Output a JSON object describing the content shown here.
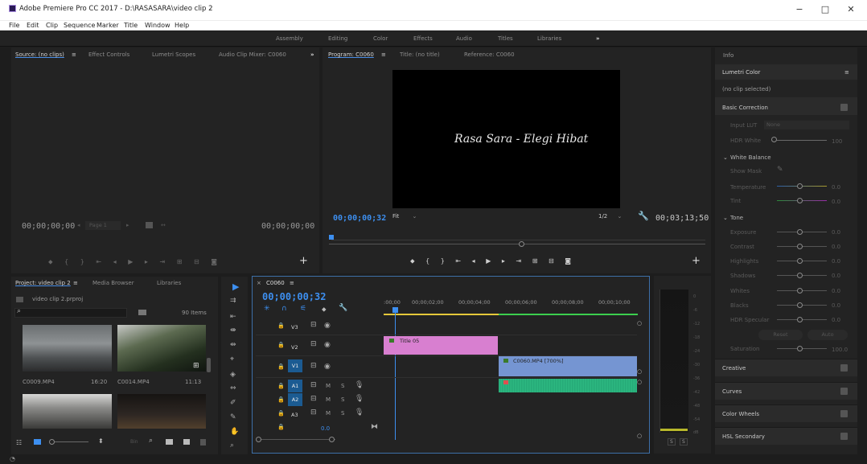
{
  "window": {
    "title": "Adobe Premiere Pro CC 2017 - D:\\RASASARA\\video clip 2",
    "minimize": "−",
    "maximize": "□",
    "close": "✕"
  },
  "menu": [
    "File",
    "Edit",
    "Clip",
    "Sequence",
    "Marker",
    "Title",
    "Window",
    "Help"
  ],
  "workspaces": [
    "Assembly",
    "Editing",
    "Color",
    "Effects",
    "Audio",
    "Titles",
    "Libraries"
  ],
  "workspaces_more": "»",
  "source": {
    "tabs": [
      "Source: (no clips)",
      "Effect Controls",
      "Lumetri Scopes",
      "Audio Clip Mixer: C0060"
    ],
    "menu_icon": "≡",
    "more": "»",
    "timecode_left": "00;00;00;00",
    "timecode_right": "00;00;00;00",
    "page": "Page 1"
  },
  "program": {
    "tabs": [
      "Program: C0060",
      "Title: (no title)",
      "Reference: C0060"
    ],
    "menu_icon": "≡",
    "title_text": "Rasa Sara - Elegi Hibat",
    "timecode": "00;00;00;32",
    "fit": "Fit",
    "resolution": "1/2",
    "duration": "00;03;13;50"
  },
  "project": {
    "tabs": [
      "Project: video clip 2",
      "Media Browser",
      "Libraries"
    ],
    "menu_icon": "≡",
    "file": "video clip 2.prproj",
    "search_placeholder": "",
    "items_count": "90 Items",
    "clips": [
      {
        "name": "C0009.MP4",
        "duration": "16:20"
      },
      {
        "name": "C0014.MP4",
        "duration": "11:13"
      }
    ],
    "bin_label": "Bin"
  },
  "timeline": {
    "close": "×",
    "sequence": "C0060",
    "menu_icon": "≡",
    "timecode": "00;00;00;32",
    "ruler": [
      ":00;00",
      "00;00;02;00",
      "00;00;04;00",
      "00;00;06;00",
      "00;00;08;00",
      "00;00;10;00"
    ],
    "tracks": [
      {
        "name": "V3"
      },
      {
        "name": "V2"
      },
      {
        "name": "V1"
      },
      {
        "name": "A1"
      },
      {
        "name": "A2"
      },
      {
        "name": "A3"
      }
    ],
    "master_value": "0.0",
    "m_label": "M",
    "s_label": "S",
    "clip_title": "Title 05",
    "clip_video": "C0060.MP4 [700%]"
  },
  "meter": {
    "scale": [
      "0",
      "-6",
      "-12",
      "-18",
      "-24",
      "-30",
      "-36",
      "-42",
      "-48",
      "-54",
      "dB"
    ],
    "solo": [
      "S",
      "S"
    ]
  },
  "lumetri": {
    "info_tab": "Info",
    "panel_title": "Lumetri Color",
    "menu_icon": "≡",
    "no_clip": "(no clip selected)",
    "basic_correction": "Basic Correction",
    "input_lut": "Input LUT",
    "lut_value": "None",
    "hdr_white": "HDR White",
    "hdr_white_val": "100",
    "white_balance": "White Balance",
    "show_mask": "Show Mask",
    "sliders": [
      {
        "label": "Temperature",
        "value": "0.0"
      },
      {
        "label": "Tint",
        "value": "0.0"
      }
    ],
    "tone": "Tone",
    "tone_sliders": [
      {
        "label": "Exposure",
        "value": "0.0"
      },
      {
        "label": "Contrast",
        "value": "0.0"
      },
      {
        "label": "Highlights",
        "value": "0.0"
      },
      {
        "label": "Shadows",
        "value": "0.0"
      },
      {
        "label": "Whites",
        "value": "0.0"
      },
      {
        "label": "Blacks",
        "value": "0.0"
      },
      {
        "label": "HDR Specular",
        "value": "0.0"
      }
    ],
    "reset": "Reset",
    "auto": "Auto",
    "saturation": "Saturation",
    "saturation_val": "100.0",
    "sections": [
      "Creative",
      "Curves",
      "Color Wheels",
      "HSL Secondary"
    ]
  }
}
